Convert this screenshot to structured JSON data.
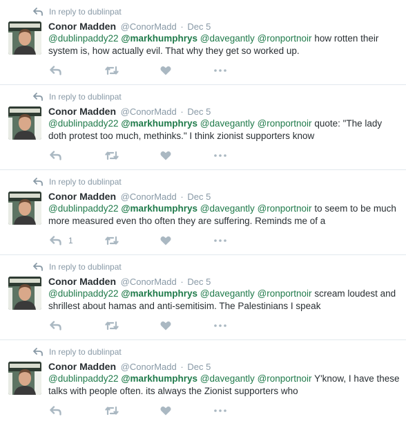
{
  "colors": {
    "mention": "#1f7a4a",
    "meta_text": "#8899a6",
    "icon": "#aab8c2",
    "divider": "#e1e8ed"
  },
  "icons": {
    "reply_context": "reply-arrow-icon",
    "reply": "reply-icon",
    "retweet": "retweet-icon",
    "like": "heart-icon",
    "more": "more-dots-icon"
  },
  "tweets": [
    {
      "reply_context": "In reply to dublinpat",
      "fullname": "Conor Madden",
      "username": "@ConorMadd",
      "separator": "·",
      "time": "Dec 5",
      "mentions": [
        "@dublinpaddy22",
        "@markhumphrys",
        "@davegantly",
        "@ronportnoir"
      ],
      "text": "how rotten their system is, how actually evil. That why they get so worked up.",
      "reply_count": ""
    },
    {
      "reply_context": "In reply to dublinpat",
      "fullname": "Conor Madden",
      "username": "@ConorMadd",
      "separator": "·",
      "time": "Dec 5",
      "mentions": [
        "@dublinpaddy22",
        "@markhumphrys",
        "@davegantly",
        "@ronportnoir"
      ],
      "text": "quote: \"The lady doth protest  too much, methinks.\" I think zionist supporters know",
      "reply_count": ""
    },
    {
      "reply_context": "In reply to dublinpat",
      "fullname": "Conor Madden",
      "username": "@ConorMadd",
      "separator": "·",
      "time": "Dec 5",
      "mentions": [
        "@dublinpaddy22",
        "@markhumphrys",
        "@davegantly",
        "@ronportnoir"
      ],
      "text": "to seem to be much more measured even tho often they are suffering. Reminds me of a",
      "reply_count": "1"
    },
    {
      "reply_context": "In reply to dublinpat",
      "fullname": "Conor Madden",
      "username": "@ConorMadd",
      "separator": "·",
      "time": "Dec 5",
      "mentions": [
        "@dublinpaddy22",
        "@markhumphrys",
        "@davegantly",
        "@ronportnoir"
      ],
      "text": "scream loudest and shrillest about hamas and anti-semitisim. The Palestinians I speak",
      "reply_count": ""
    },
    {
      "reply_context": "In reply to dublinpat",
      "fullname": "Conor Madden",
      "username": "@ConorMadd",
      "separator": "·",
      "time": "Dec 5",
      "mentions": [
        "@dublinpaddy22",
        "@markhumphrys",
        "@davegantly",
        "@ronportnoir"
      ],
      "text": "Y'know, I have these talks with people often. its always the Zionist supporters who",
      "reply_count": ""
    }
  ]
}
